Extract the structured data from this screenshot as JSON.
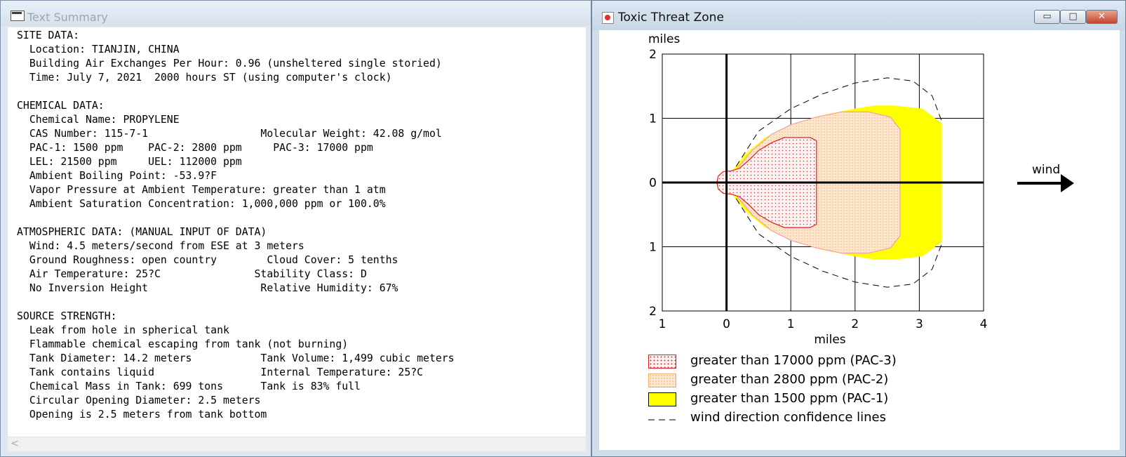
{
  "text_window": {
    "title": "Text Summary",
    "lines": [
      "SITE DATA:",
      "  Location: TIANJIN, CHINA",
      "  Building Air Exchanges Per Hour: 0.96 (unsheltered single storied)",
      "  Time: July 7, 2021  2000 hours ST (using computer's clock)",
      "",
      "CHEMICAL DATA:",
      "  Chemical Name: PROPYLENE",
      "  CAS Number: 115-7-1                  Molecular Weight: 42.08 g/mol",
      "  PAC-1: 1500 ppm    PAC-2: 2800 ppm     PAC-3: 17000 ppm",
      "  LEL: 21500 ppm     UEL: 112000 ppm",
      "  Ambient Boiling Point: -53.9?F",
      "  Vapor Pressure at Ambient Temperature: greater than 1 atm",
      "  Ambient Saturation Concentration: 1,000,000 ppm or 100.0%",
      "",
      "ATMOSPHERIC DATA: (MANUAL INPUT OF DATA)",
      "  Wind: 4.5 meters/second from ESE at 3 meters",
      "  Ground Roughness: open country        Cloud Cover: 5 tenths",
      "  Air Temperature: 25?C               Stability Class: D",
      "  No Inversion Height                  Relative Humidity: 67%",
      "",
      "SOURCE STRENGTH:",
      "  Leak from hole in spherical tank",
      "  Flammable chemical escaping from tank (not burning)",
      "  Tank Diameter: 14.2 meters           Tank Volume: 1,499 cubic meters",
      "  Tank contains liquid                 Internal Temperature: 25?C",
      "  Chemical Mass in Tank: 699 tons      Tank is 83% full",
      "  Circular Opening Diameter: 2.5 meters",
      "  Opening is 2.5 meters from tank bottom"
    ],
    "scroll_left_glyph": "<"
  },
  "toxic_window": {
    "title": "Toxic Threat Zone",
    "buttons": {
      "minimize": "▭",
      "maximize": "□",
      "close": "✕"
    }
  },
  "chart_data": {
    "type": "area",
    "x_unit_label": "miles",
    "y_unit_label": "miles",
    "x_ticks": [
      "1",
      "0",
      "1",
      "2",
      "3",
      "4"
    ],
    "x_tick_values": [
      -1,
      0,
      1,
      2,
      3,
      4
    ],
    "y_ticks": [
      "2",
      "1",
      "0",
      "1",
      "2"
    ],
    "y_tick_values": [
      2,
      1,
      0,
      -1,
      -2
    ],
    "xlim": [
      -1,
      4
    ],
    "ylim": [
      -2,
      2
    ],
    "grid": true,
    "wind_label": "wind",
    "zones": [
      {
        "name": "PAC-3",
        "fill": "dots",
        "color": "#ff0000",
        "points": [
          [
            -0.15,
            0
          ],
          [
            -0.13,
            0.1
          ],
          [
            -0.05,
            0.17
          ],
          [
            0.07,
            0.18
          ],
          [
            0.2,
            0.22
          ],
          [
            0.35,
            0.35
          ],
          [
            0.5,
            0.5
          ],
          [
            0.7,
            0.62
          ],
          [
            0.9,
            0.7
          ],
          [
            1.3,
            0.7
          ],
          [
            1.4,
            0.65
          ],
          [
            1.4,
            -0.65
          ],
          [
            1.3,
            -0.7
          ],
          [
            0.9,
            -0.7
          ],
          [
            0.7,
            -0.62
          ],
          [
            0.5,
            -0.5
          ],
          [
            0.35,
            -0.35
          ],
          [
            0.2,
            -0.22
          ],
          [
            0.07,
            -0.18
          ],
          [
            -0.05,
            -0.17
          ],
          [
            -0.13,
            -0.1
          ]
        ]
      },
      {
        "name": "PAC-2",
        "fill": "hatch",
        "color": "#f5c896",
        "points": [
          [
            0.15,
            0.2
          ],
          [
            0.4,
            0.5
          ],
          [
            0.7,
            0.75
          ],
          [
            1,
            0.9
          ],
          [
            1.4,
            1.02
          ],
          [
            1.8,
            1.1
          ],
          [
            2.2,
            1.1
          ],
          [
            2.55,
            1.02
          ],
          [
            2.7,
            0.83
          ],
          [
            2.7,
            -0.83
          ],
          [
            2.55,
            -1.02
          ],
          [
            2.2,
            -1.1
          ],
          [
            1.8,
            -1.1
          ],
          [
            1.4,
            -1.02
          ],
          [
            1,
            -0.9
          ],
          [
            0.7,
            -0.75
          ],
          [
            0.4,
            -0.5
          ],
          [
            0.15,
            -0.2
          ]
        ]
      },
      {
        "name": "PAC-1",
        "fill": "solid",
        "color": "#ffff00",
        "points": [
          [
            0.1,
            0.2
          ],
          [
            0.3,
            0.45
          ],
          [
            0.6,
            0.7
          ],
          [
            1,
            0.9
          ],
          [
            1.5,
            1.05
          ],
          [
            2,
            1.15
          ],
          [
            2.3,
            1.2
          ],
          [
            2.6,
            1.2
          ],
          [
            3.05,
            1.15
          ],
          [
            3.35,
            0.92
          ],
          [
            3.35,
            -0.92
          ],
          [
            3.05,
            -1.15
          ],
          [
            2.6,
            -1.2
          ],
          [
            2.3,
            -1.2
          ],
          [
            2,
            -1.15
          ],
          [
            1.5,
            -1.05
          ],
          [
            1,
            -0.9
          ],
          [
            0.6,
            -0.7
          ],
          [
            0.3,
            -0.45
          ],
          [
            0.1,
            -0.2
          ]
        ]
      }
    ],
    "confidence_lines": [
      [
        [
          0.15,
          0.25
        ],
        [
          0.5,
          0.8
        ],
        [
          1,
          1.15
        ],
        [
          1.5,
          1.38
        ],
        [
          2,
          1.55
        ],
        [
          2.5,
          1.63
        ],
        [
          2.9,
          1.58
        ],
        [
          3.2,
          1.35
        ],
        [
          3.35,
          0.95
        ]
      ],
      [
        [
          0.15,
          -0.25
        ],
        [
          0.5,
          -0.8
        ],
        [
          1,
          -1.15
        ],
        [
          1.5,
          -1.38
        ],
        [
          2,
          -1.55
        ],
        [
          2.5,
          -1.63
        ],
        [
          2.9,
          -1.58
        ],
        [
          3.2,
          -1.35
        ],
        [
          3.35,
          -0.95
        ]
      ]
    ],
    "legend": [
      {
        "key": "pac3",
        "label": "greater than 17000 ppm (PAC-3)"
      },
      {
        "key": "pac2",
        "label": "greater than 2800 ppm (PAC-2)"
      },
      {
        "key": "pac1",
        "label": "greater than 1500 ppm (PAC-1)"
      },
      {
        "key": "conf",
        "label": "wind direction confidence lines"
      }
    ]
  }
}
